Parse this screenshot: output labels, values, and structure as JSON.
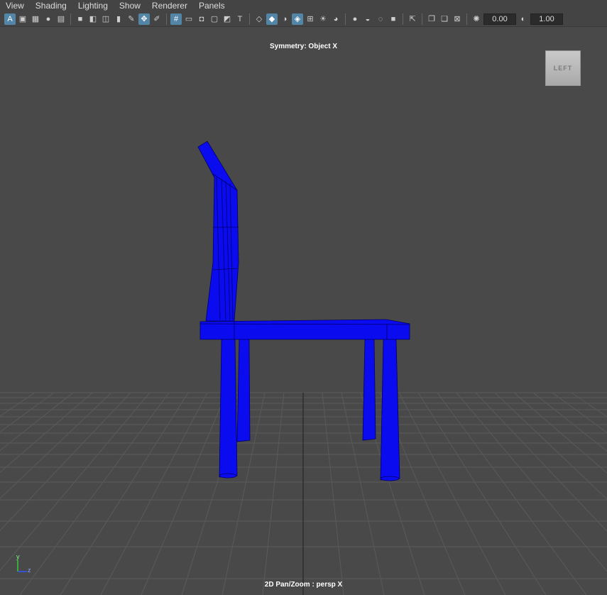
{
  "menus": [
    "View",
    "Shading",
    "Lighting",
    "Show",
    "Renderer",
    "Panels"
  ],
  "toolbar": {
    "exposure_value": "0.00",
    "gamma_value": "1.00"
  },
  "viewport": {
    "symmetry_label": "Symmetry: Object X",
    "camera_label": "2D Pan/Zoom : persp X",
    "viewcube_label": "LEFT",
    "axis_y": "y",
    "axis_z": "z"
  },
  "colors": {
    "model": "#0b0bf0",
    "wire": "#000066",
    "grid": "#5a5a5a",
    "background": "#494949"
  }
}
